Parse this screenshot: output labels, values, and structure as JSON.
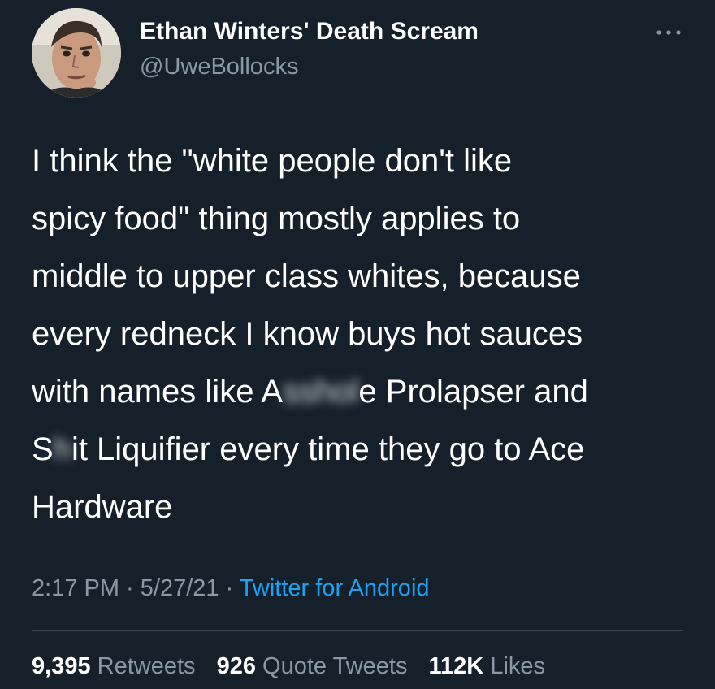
{
  "author": {
    "display_name": "Ethan Winters' Death Scream",
    "handle": "@UweBollocks",
    "avatar_icon": "user-photo-icon"
  },
  "more_icon": "more-options-icon",
  "tweet": {
    "lines": [
      {
        "text": "I think the \"white people don't like"
      },
      {
        "text": "spicy food\" thing mostly applies to"
      },
      {
        "text": "middle to upper class whites, because"
      },
      {
        "text": "every redneck I know buys hot sauces"
      },
      {
        "before": "with names like A",
        "censored": "sshol",
        "after": "e Prolapser and"
      },
      {
        "before": "S",
        "censored": "h",
        "after": "it Liquifier every time they go to Ace"
      },
      {
        "text": "Hardware"
      }
    ]
  },
  "meta": {
    "time": "2:17 PM",
    "sep1": " · ",
    "date": "5/27/21",
    "sep2": " · ",
    "source": "Twitter for Android"
  },
  "stats": {
    "retweets": {
      "count": "9,395",
      "label": "Retweets"
    },
    "quotes": {
      "count": "926",
      "label": "Quote Tweets"
    },
    "likes": {
      "count": "112K",
      "label": "Likes"
    }
  },
  "colors": {
    "background": "#15202b",
    "secondary_text": "#8899a6",
    "link": "#1da1f2"
  }
}
